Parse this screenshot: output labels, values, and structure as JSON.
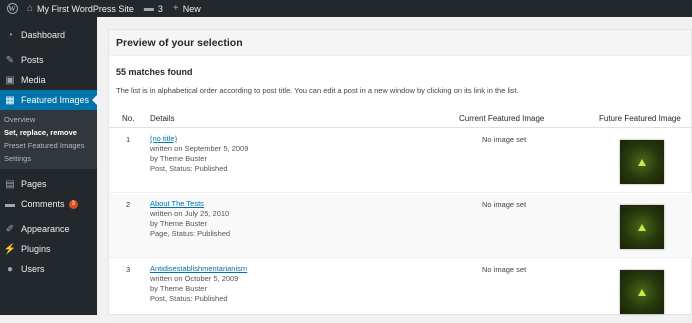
{
  "adminbar": {
    "site_name": "My First WordPress Site",
    "comments_count": "3",
    "new_label": "New"
  },
  "sidebar": {
    "dashboard": "Dashboard",
    "posts": "Posts",
    "media": "Media",
    "featured_images": "Featured Images",
    "sub": {
      "overview": "Overview",
      "set_replace_remove": "Set, replace, remove",
      "preset": "Preset Featured Images",
      "settings": "Settings"
    },
    "pages": "Pages",
    "comments": "Comments",
    "comments_badge": "3",
    "appearance": "Appearance",
    "plugins": "Plugins",
    "users": "Users"
  },
  "main": {
    "panel_title": "Preview of your selection",
    "matches": "55 matches found",
    "note": "The list is in alphabetical order according to post title. You can edit a post in a new window by clicking on its link in the list.",
    "columns": {
      "no": "No.",
      "details": "Details",
      "current": "Current Featured Image",
      "future": "Future Featured Image"
    },
    "rows": [
      {
        "no": "1",
        "title": "(no title)",
        "written": "written on September 5, 2009",
        "by": "by Theme Buster",
        "status": "Post, Status: Published",
        "current": "No image set"
      },
      {
        "no": "2",
        "title": "About The Tests",
        "written": "written on July 25, 2010",
        "by": "by Theme Buster",
        "status": "Page, Status: Published",
        "current": "No image set"
      },
      {
        "no": "3",
        "title": "Antidisestablishmentarianism",
        "written": "written on October 5, 2009",
        "by": "by Theme Buster",
        "status": "Post, Status: Published",
        "current": "No image set"
      }
    ]
  }
}
